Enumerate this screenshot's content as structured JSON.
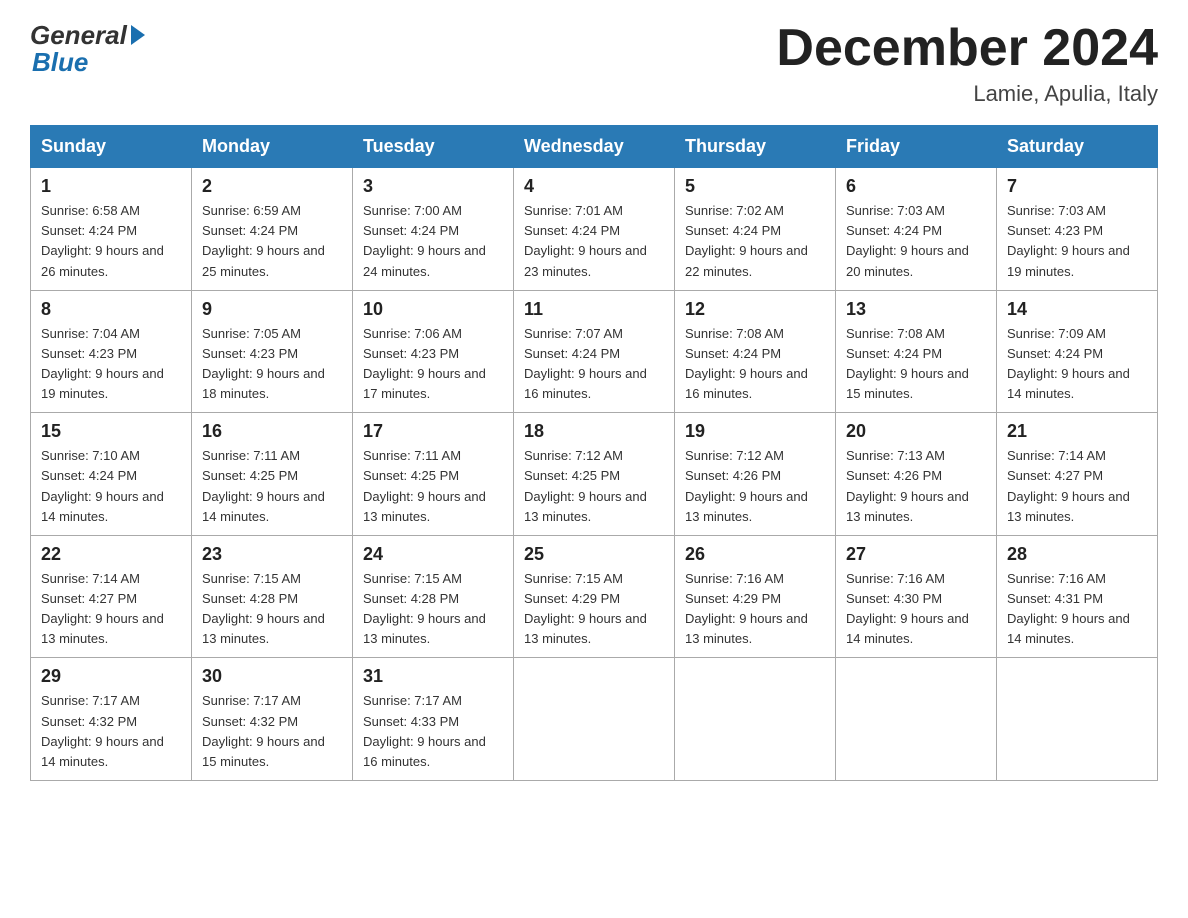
{
  "header": {
    "logo_general": "General",
    "logo_blue": "Blue",
    "title": "December 2024",
    "subtitle": "Lamie, Apulia, Italy"
  },
  "days_of_week": [
    "Sunday",
    "Monday",
    "Tuesday",
    "Wednesday",
    "Thursday",
    "Friday",
    "Saturday"
  ],
  "weeks": [
    [
      {
        "day": "1",
        "sunrise": "Sunrise: 6:58 AM",
        "sunset": "Sunset: 4:24 PM",
        "daylight": "Daylight: 9 hours and 26 minutes."
      },
      {
        "day": "2",
        "sunrise": "Sunrise: 6:59 AM",
        "sunset": "Sunset: 4:24 PM",
        "daylight": "Daylight: 9 hours and 25 minutes."
      },
      {
        "day": "3",
        "sunrise": "Sunrise: 7:00 AM",
        "sunset": "Sunset: 4:24 PM",
        "daylight": "Daylight: 9 hours and 24 minutes."
      },
      {
        "day": "4",
        "sunrise": "Sunrise: 7:01 AM",
        "sunset": "Sunset: 4:24 PM",
        "daylight": "Daylight: 9 hours and 23 minutes."
      },
      {
        "day": "5",
        "sunrise": "Sunrise: 7:02 AM",
        "sunset": "Sunset: 4:24 PM",
        "daylight": "Daylight: 9 hours and 22 minutes."
      },
      {
        "day": "6",
        "sunrise": "Sunrise: 7:03 AM",
        "sunset": "Sunset: 4:24 PM",
        "daylight": "Daylight: 9 hours and 20 minutes."
      },
      {
        "day": "7",
        "sunrise": "Sunrise: 7:03 AM",
        "sunset": "Sunset: 4:23 PM",
        "daylight": "Daylight: 9 hours and 19 minutes."
      }
    ],
    [
      {
        "day": "8",
        "sunrise": "Sunrise: 7:04 AM",
        "sunset": "Sunset: 4:23 PM",
        "daylight": "Daylight: 9 hours and 19 minutes."
      },
      {
        "day": "9",
        "sunrise": "Sunrise: 7:05 AM",
        "sunset": "Sunset: 4:23 PM",
        "daylight": "Daylight: 9 hours and 18 minutes."
      },
      {
        "day": "10",
        "sunrise": "Sunrise: 7:06 AM",
        "sunset": "Sunset: 4:23 PM",
        "daylight": "Daylight: 9 hours and 17 minutes."
      },
      {
        "day": "11",
        "sunrise": "Sunrise: 7:07 AM",
        "sunset": "Sunset: 4:24 PM",
        "daylight": "Daylight: 9 hours and 16 minutes."
      },
      {
        "day": "12",
        "sunrise": "Sunrise: 7:08 AM",
        "sunset": "Sunset: 4:24 PM",
        "daylight": "Daylight: 9 hours and 16 minutes."
      },
      {
        "day": "13",
        "sunrise": "Sunrise: 7:08 AM",
        "sunset": "Sunset: 4:24 PM",
        "daylight": "Daylight: 9 hours and 15 minutes."
      },
      {
        "day": "14",
        "sunrise": "Sunrise: 7:09 AM",
        "sunset": "Sunset: 4:24 PM",
        "daylight": "Daylight: 9 hours and 14 minutes."
      }
    ],
    [
      {
        "day": "15",
        "sunrise": "Sunrise: 7:10 AM",
        "sunset": "Sunset: 4:24 PM",
        "daylight": "Daylight: 9 hours and 14 minutes."
      },
      {
        "day": "16",
        "sunrise": "Sunrise: 7:11 AM",
        "sunset": "Sunset: 4:25 PM",
        "daylight": "Daylight: 9 hours and 14 minutes."
      },
      {
        "day": "17",
        "sunrise": "Sunrise: 7:11 AM",
        "sunset": "Sunset: 4:25 PM",
        "daylight": "Daylight: 9 hours and 13 minutes."
      },
      {
        "day": "18",
        "sunrise": "Sunrise: 7:12 AM",
        "sunset": "Sunset: 4:25 PM",
        "daylight": "Daylight: 9 hours and 13 minutes."
      },
      {
        "day": "19",
        "sunrise": "Sunrise: 7:12 AM",
        "sunset": "Sunset: 4:26 PM",
        "daylight": "Daylight: 9 hours and 13 minutes."
      },
      {
        "day": "20",
        "sunrise": "Sunrise: 7:13 AM",
        "sunset": "Sunset: 4:26 PM",
        "daylight": "Daylight: 9 hours and 13 minutes."
      },
      {
        "day": "21",
        "sunrise": "Sunrise: 7:14 AM",
        "sunset": "Sunset: 4:27 PM",
        "daylight": "Daylight: 9 hours and 13 minutes."
      }
    ],
    [
      {
        "day": "22",
        "sunrise": "Sunrise: 7:14 AM",
        "sunset": "Sunset: 4:27 PM",
        "daylight": "Daylight: 9 hours and 13 minutes."
      },
      {
        "day": "23",
        "sunrise": "Sunrise: 7:15 AM",
        "sunset": "Sunset: 4:28 PM",
        "daylight": "Daylight: 9 hours and 13 minutes."
      },
      {
        "day": "24",
        "sunrise": "Sunrise: 7:15 AM",
        "sunset": "Sunset: 4:28 PM",
        "daylight": "Daylight: 9 hours and 13 minutes."
      },
      {
        "day": "25",
        "sunrise": "Sunrise: 7:15 AM",
        "sunset": "Sunset: 4:29 PM",
        "daylight": "Daylight: 9 hours and 13 minutes."
      },
      {
        "day": "26",
        "sunrise": "Sunrise: 7:16 AM",
        "sunset": "Sunset: 4:29 PM",
        "daylight": "Daylight: 9 hours and 13 minutes."
      },
      {
        "day": "27",
        "sunrise": "Sunrise: 7:16 AM",
        "sunset": "Sunset: 4:30 PM",
        "daylight": "Daylight: 9 hours and 14 minutes."
      },
      {
        "day": "28",
        "sunrise": "Sunrise: 7:16 AM",
        "sunset": "Sunset: 4:31 PM",
        "daylight": "Daylight: 9 hours and 14 minutes."
      }
    ],
    [
      {
        "day": "29",
        "sunrise": "Sunrise: 7:17 AM",
        "sunset": "Sunset: 4:32 PM",
        "daylight": "Daylight: 9 hours and 14 minutes."
      },
      {
        "day": "30",
        "sunrise": "Sunrise: 7:17 AM",
        "sunset": "Sunset: 4:32 PM",
        "daylight": "Daylight: 9 hours and 15 minutes."
      },
      {
        "day": "31",
        "sunrise": "Sunrise: 7:17 AM",
        "sunset": "Sunset: 4:33 PM",
        "daylight": "Daylight: 9 hours and 16 minutes."
      },
      null,
      null,
      null,
      null
    ]
  ]
}
